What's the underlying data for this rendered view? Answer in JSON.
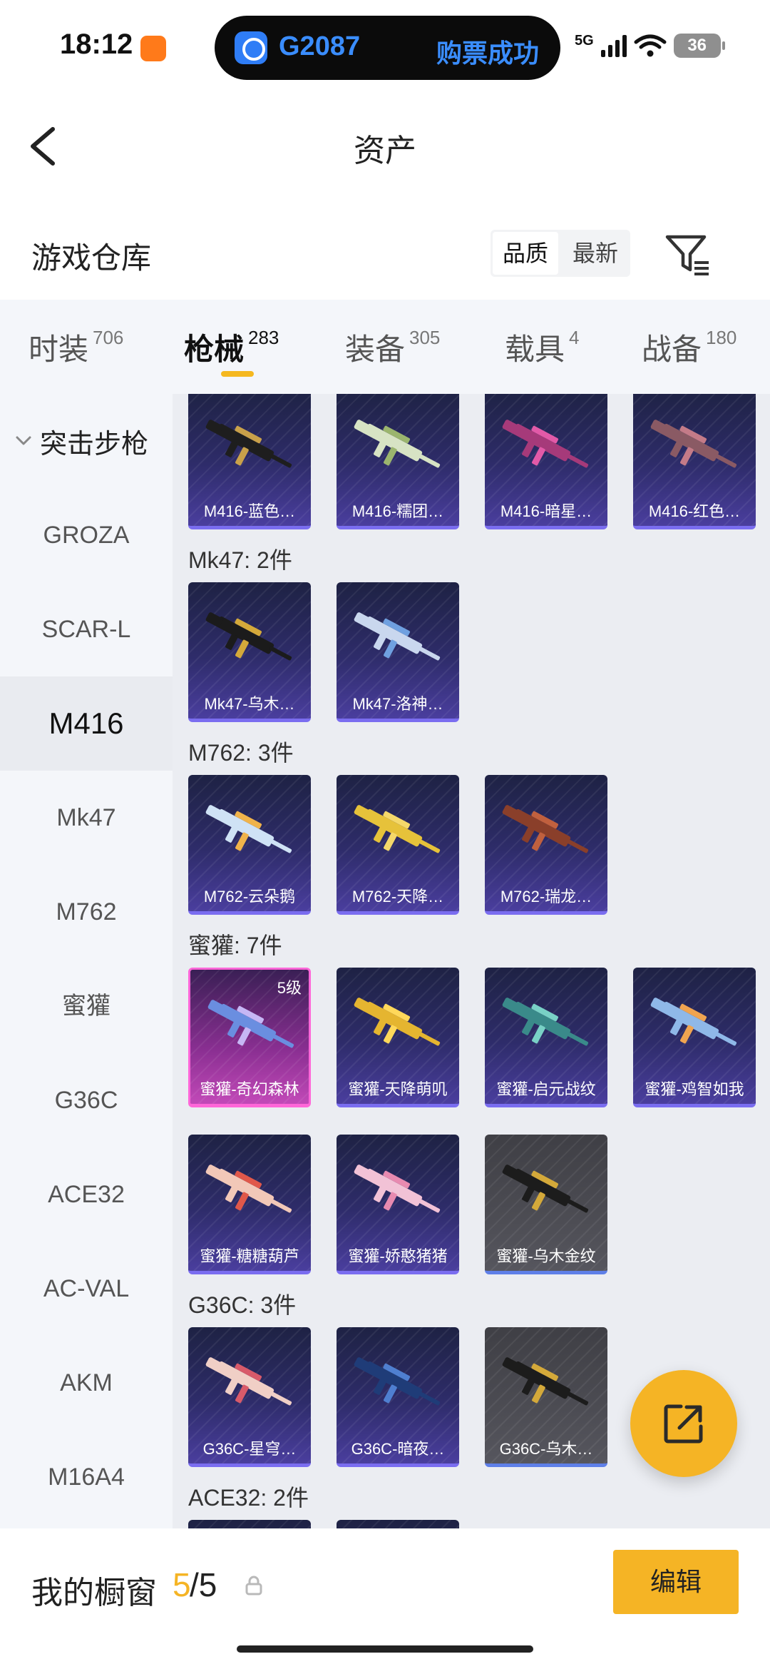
{
  "status_bar": {
    "time": "18:12",
    "network": "5G",
    "battery": "36",
    "live_activity": {
      "train": "G2087",
      "status": "购票成功"
    }
  },
  "header": {
    "title": "资产"
  },
  "section": {
    "title": "游戏仓库",
    "sort_options": [
      "品质",
      "最新"
    ],
    "sort_selected": "品质"
  },
  "tabs": [
    {
      "label": "时装",
      "count": "706"
    },
    {
      "label": "枪械",
      "count": "283",
      "active": true
    },
    {
      "label": "装备",
      "count": "305"
    },
    {
      "label": "载具",
      "count": "4"
    },
    {
      "label": "战备",
      "count": "180"
    }
  ],
  "categories": {
    "parent": "突击步枪",
    "items": [
      "GROZA",
      "SCAR-L",
      "M416",
      "Mk47",
      "M762",
      "蜜獾",
      "G36C",
      "ACE32",
      "AC-VAL",
      "AKM",
      "M16A4"
    ],
    "selected": "M416"
  },
  "groups": [
    {
      "label": "",
      "items": [
        {
          "name": "M416-蓝色…",
          "color": "#1e1e1e",
          "accent": "#c9a14a",
          "style": "normal"
        },
        {
          "name": "M416-糯团…",
          "color": "#d7e3c4",
          "accent": "#9bb56e",
          "style": "normal"
        },
        {
          "name": "M416-暗星…",
          "color": "#a63a7a",
          "accent": "#e25aa8",
          "style": "normal"
        },
        {
          "name": "M416-红色…",
          "color": "#8a5a64",
          "accent": "#c47b88",
          "style": "normal"
        }
      ]
    },
    {
      "label": "Mk47: 2件",
      "items": [
        {
          "name": "Mk47-乌木…",
          "color": "#1b1b1b",
          "accent": "#d4a93a",
          "style": "normal"
        },
        {
          "name": "Mk47-洛神…",
          "color": "#c9d7ee",
          "accent": "#6fa0e0",
          "style": "normal"
        }
      ]
    },
    {
      "label": "M762: 3件",
      "items": [
        {
          "name": "M762-云朵鹅",
          "color": "#cfe2f5",
          "accent": "#f0b34a",
          "style": "normal"
        },
        {
          "name": "M762-天降…",
          "color": "#e6c23a",
          "accent": "#f4d86a",
          "style": "normal"
        },
        {
          "name": "M762-瑞龙…",
          "color": "#8a3f2a",
          "accent": "#c0603e",
          "style": "normal"
        }
      ]
    },
    {
      "label": "蜜獾: 7件",
      "items": [
        {
          "name": "蜜獾-奇幻森林",
          "color": "#6a8ee0",
          "accent": "#c6b7f5",
          "style": "rare",
          "level": "5级"
        },
        {
          "name": "蜜獾-天降萌叽",
          "color": "#e5b530",
          "accent": "#ffd85a",
          "style": "normal"
        },
        {
          "name": "蜜獾-启元战纹",
          "color": "#3a8a8a",
          "accent": "#79d1c6",
          "style": "normal"
        },
        {
          "name": "蜜獾-鸡智如我",
          "color": "#8fb8e8",
          "accent": "#f0a450",
          "style": "normal"
        },
        {
          "name": "蜜獾-糖糖葫芦",
          "color": "#f2c8b8",
          "accent": "#e0584a",
          "style": "normal"
        },
        {
          "name": "蜜獾-娇憨猪猪",
          "color": "#f2c2d6",
          "accent": "#e88ab0",
          "style": "normal"
        },
        {
          "name": "蜜獾-乌木金纹",
          "color": "#1c1c1c",
          "accent": "#d4a93a",
          "style": "grey"
        }
      ]
    },
    {
      "label": "G36C: 3件",
      "items": [
        {
          "name": "G36C-星穹…",
          "color": "#f0cfc6",
          "accent": "#d85a6a",
          "style": "normal"
        },
        {
          "name": "G36C-暗夜…",
          "color": "#1f3c78",
          "accent": "#4f7fd0",
          "style": "normal"
        },
        {
          "name": "G36C-乌木…",
          "color": "#1c1c1c",
          "accent": "#d4a93a",
          "style": "grey"
        }
      ]
    },
    {
      "label": "ACE32: 2件",
      "items": [
        {
          "name": "",
          "color": "#2a2a2a",
          "accent": "#888888",
          "style": "normal"
        },
        {
          "name": "",
          "color": "#2a2a2a",
          "accent": "#888888",
          "style": "normal"
        }
      ]
    }
  ],
  "showcase": {
    "label": "我的橱窗",
    "used": "5",
    "total": "/5"
  },
  "edit_label": "编辑"
}
